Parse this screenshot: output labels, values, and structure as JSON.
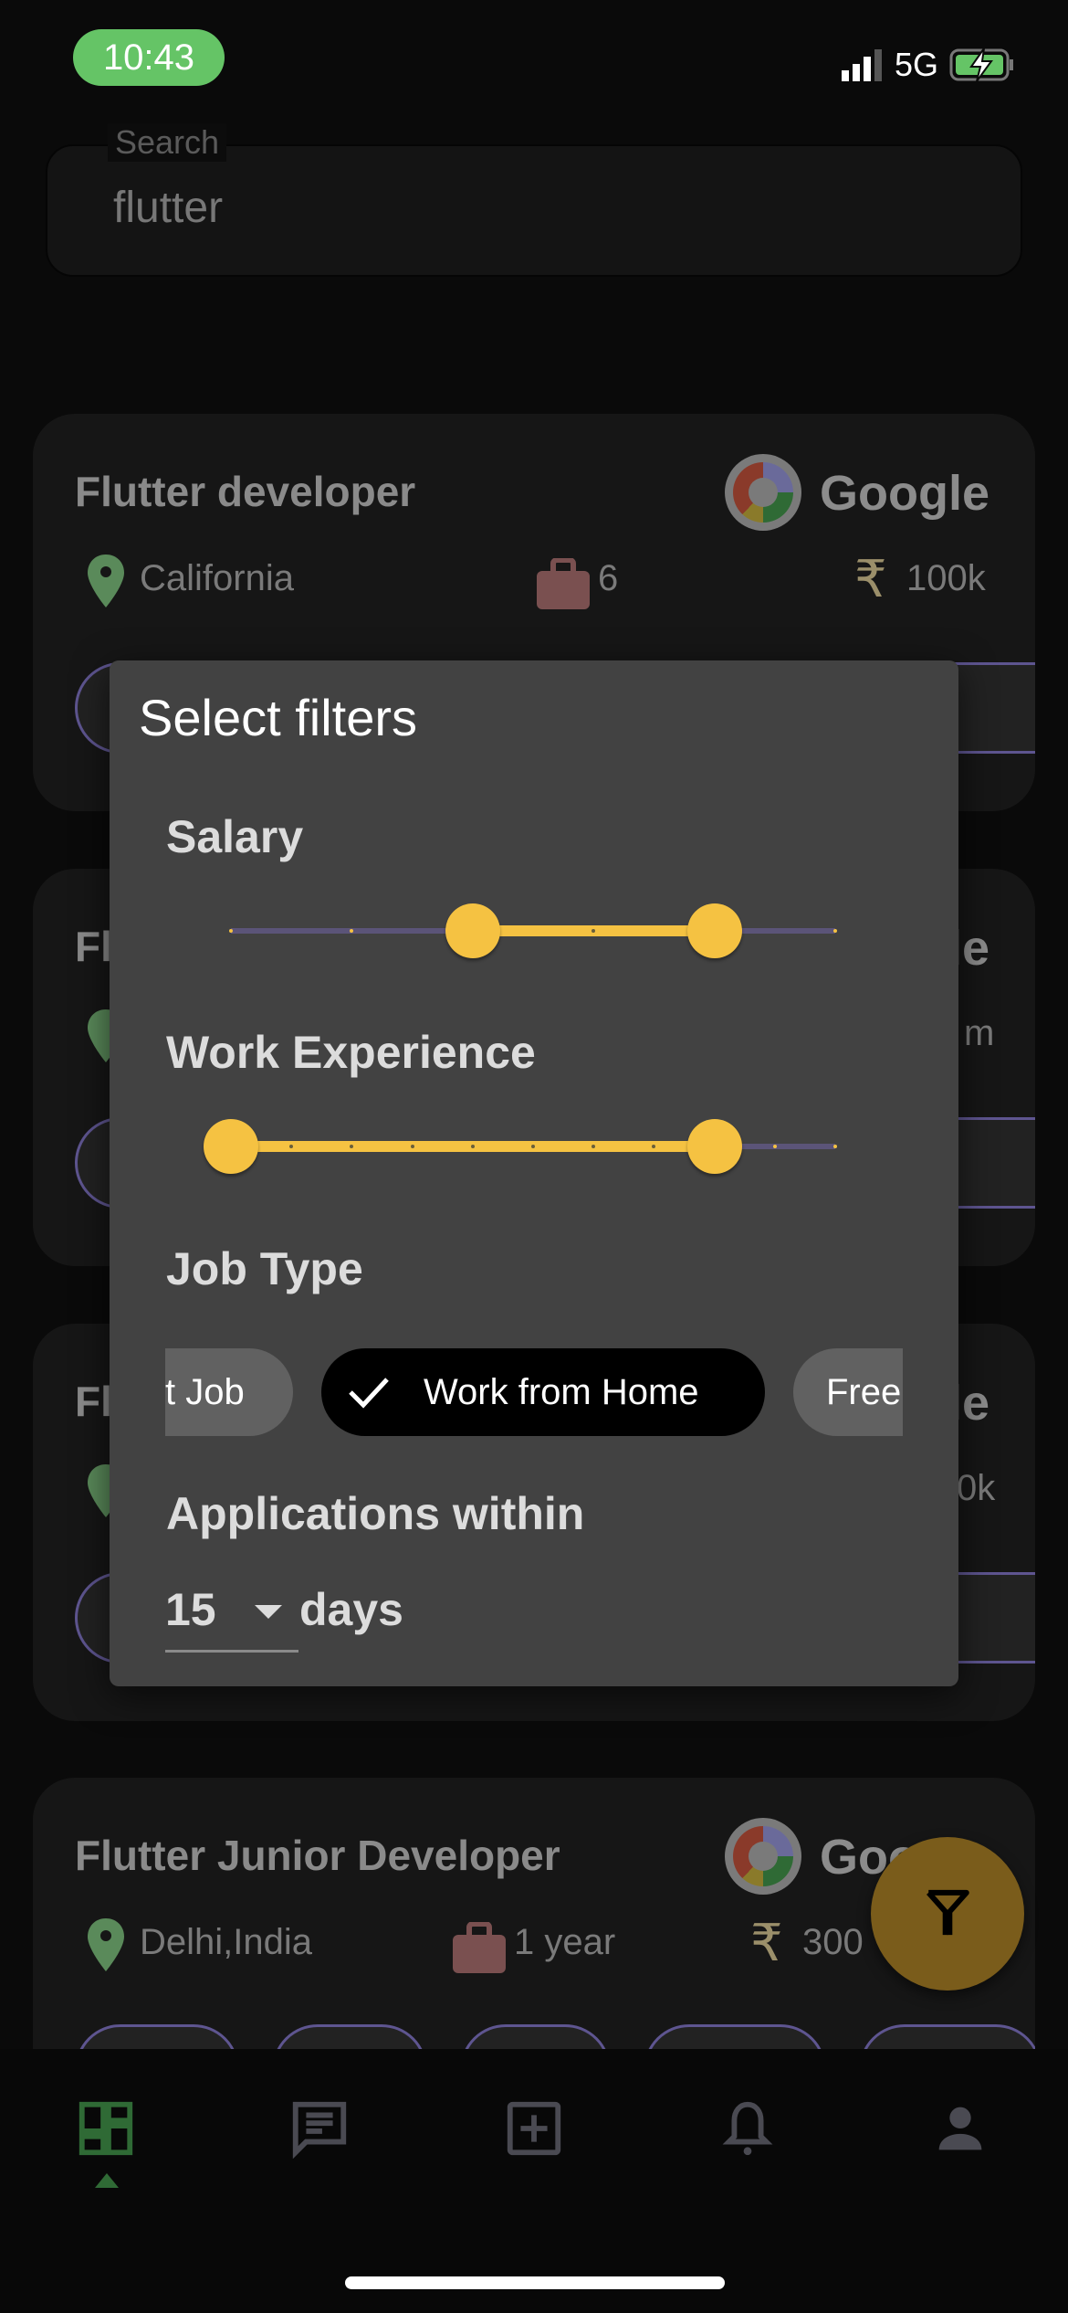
{
  "status_bar": {
    "time": "10:43",
    "network": "5G",
    "icons": [
      "signal-icon",
      "battery-charging-icon"
    ]
  },
  "search": {
    "label": "Search",
    "value": "flutter"
  },
  "job_cards": [
    {
      "title": "Flutter developer",
      "company": "Google",
      "location": "California",
      "experience": "6",
      "salary": "100k"
    },
    {
      "title_fragment": "Fl",
      "company": "Google",
      "salary_fragment": "m"
    },
    {
      "title_fragment": "Fl",
      "company": "Google",
      "salary_fragment": "0k"
    },
    {
      "title": "Flutter Junior Developer",
      "company": "Google",
      "location": "Delhi,India",
      "experience": "1 year",
      "salary": "300"
    }
  ],
  "filter_dialog": {
    "title": "Select filters",
    "salary": {
      "label": "Salary",
      "divisions": 5,
      "range_start_step": 2,
      "range_end_step": 4
    },
    "work_experience": {
      "label": "Work Experience",
      "divisions": 10,
      "range_start_step": 0,
      "range_end_step": 8
    },
    "job_type": {
      "label": "Job Type",
      "chips": [
        {
          "label": "t Job",
          "selected": false
        },
        {
          "label": "Work from Home",
          "selected": true
        },
        {
          "label": "Free",
          "selected": false
        }
      ]
    },
    "applications_within": {
      "label": "Applications within",
      "value": "15",
      "unit": "days"
    }
  },
  "bottom_nav": {
    "items": [
      "dashboard-icon",
      "chat-icon",
      "add-box-icon",
      "notifications-icon",
      "person-icon"
    ],
    "active_index": 0
  },
  "colors": {
    "accent": "#f5c242",
    "active_nav": "#2f6a35",
    "fab": "#7a5c1b",
    "dialog": "#424242",
    "chip_selected": "#000000"
  }
}
